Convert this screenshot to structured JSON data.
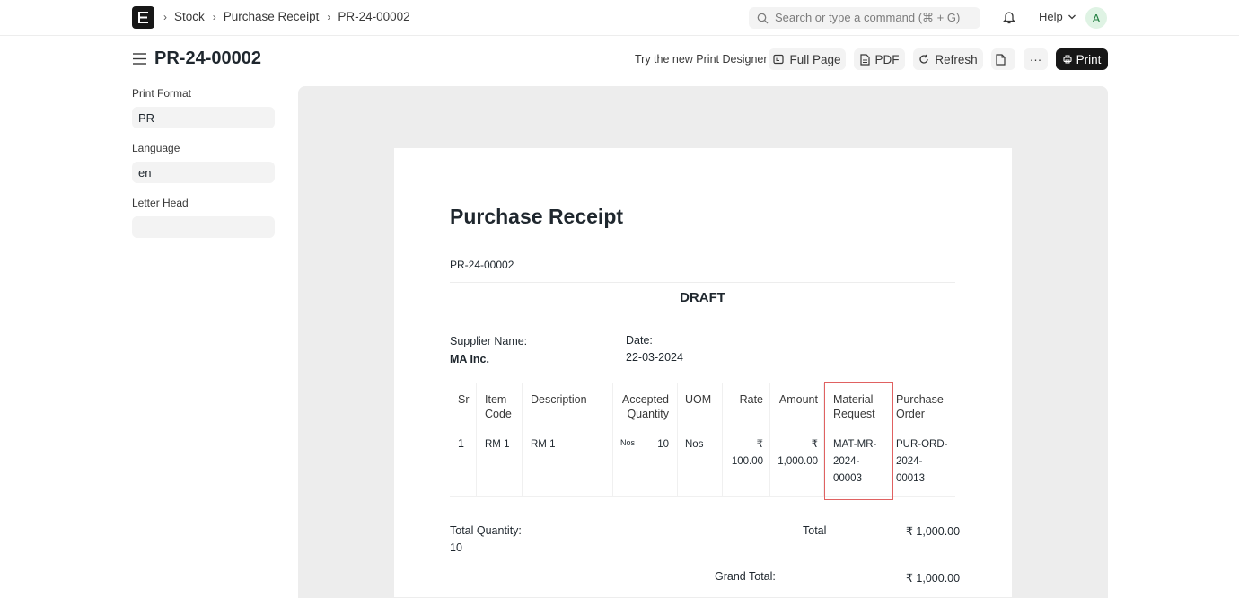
{
  "navbar": {
    "logo_letter": "E",
    "breadcrumbs": [
      "Stock",
      "Purchase Receipt",
      "PR-24-00002"
    ],
    "search_placeholder": "Search or type a command (⌘ + G)",
    "help_label": "Help",
    "avatar_initial": "A"
  },
  "page": {
    "title": "PR-24-00002",
    "try_link": "Try the new Print Designer",
    "buttons": {
      "full_page": "Full Page",
      "pdf": "PDF",
      "refresh": "Refresh",
      "more": "···",
      "print": "Print"
    }
  },
  "sidebar": {
    "fields": [
      {
        "label": "Print Format",
        "value": "PR"
      },
      {
        "label": "Language",
        "value": "en"
      },
      {
        "label": "Letter Head",
        "value": ""
      }
    ]
  },
  "document": {
    "title": "Purchase Receipt",
    "name": "PR-24-00002",
    "status": "DRAFT",
    "supplier_label": "Supplier Name:",
    "supplier_value": "MA Inc.",
    "date_label": "Date:",
    "date_value": "22-03-2024",
    "table": {
      "headers": {
        "sr": "Sr",
        "item_code": [
          "Item",
          "Code"
        ],
        "description": "Description",
        "accepted_qty": [
          "Accepted",
          "Quantity"
        ],
        "uom": "UOM",
        "rate": "Rate",
        "amount": "Amount",
        "material_request": [
          "Material",
          "Request"
        ],
        "purchase_order": [
          "Purchase",
          "Order"
        ]
      },
      "rows": [
        {
          "sr": "1",
          "item_code": "RM 1",
          "description": "RM 1",
          "stock_uom": "Nos",
          "accepted_qty": "10",
          "uom": "Nos",
          "rate": [
            "₹",
            "100.00"
          ],
          "amount": [
            "₹",
            "1,000.00"
          ],
          "material_request": [
            "MAT-MR-",
            "2024-",
            "00003"
          ],
          "purchase_order": [
            "PUR-ORD-",
            "2024-",
            "00013"
          ]
        }
      ]
    },
    "total_qty_label": "Total Quantity:",
    "total_qty_value": "10",
    "total_label": "Total",
    "total_value": "₹ 1,000.00",
    "grand_total_label": "Grand Total:",
    "grand_total_value": "₹ 1,000.00"
  }
}
